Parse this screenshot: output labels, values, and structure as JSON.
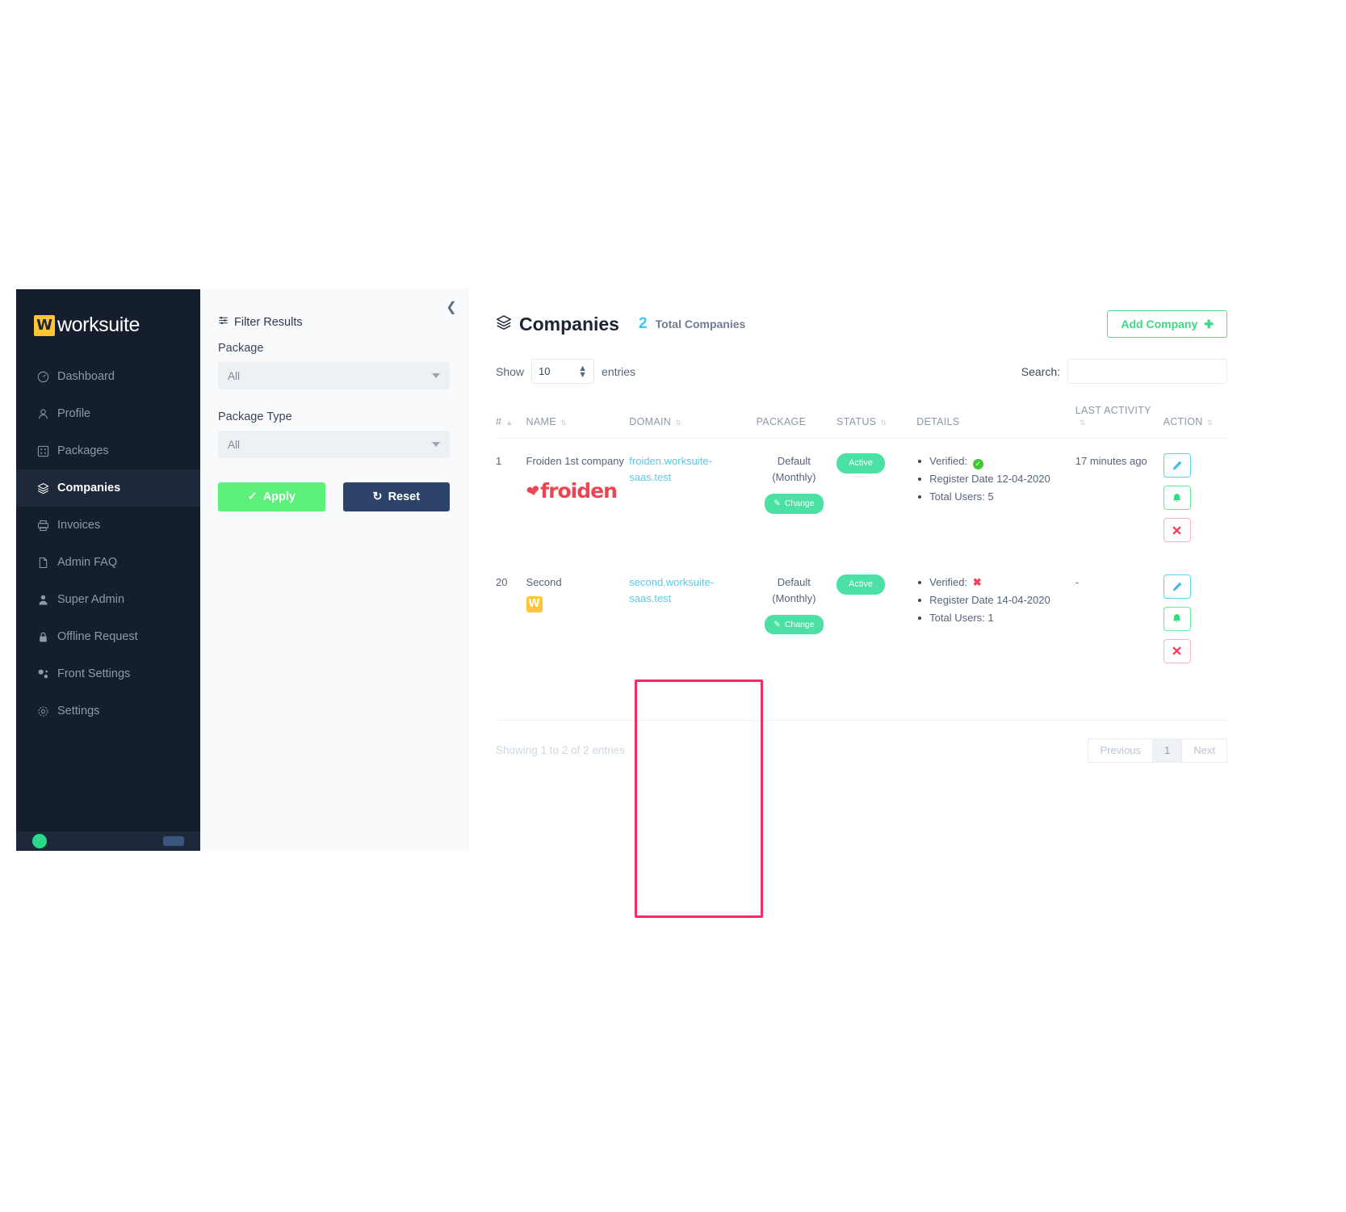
{
  "brand": {
    "mark": "W",
    "name": "worksuite"
  },
  "sidebar": {
    "items": [
      {
        "label": "Dashboard",
        "icon": "speedometer-icon",
        "active": false
      },
      {
        "label": "Profile",
        "icon": "user-icon",
        "active": false
      },
      {
        "label": "Packages",
        "icon": "grid-icon",
        "active": false
      },
      {
        "label": "Companies",
        "icon": "layers-icon",
        "active": true
      },
      {
        "label": "Invoices",
        "icon": "printer-icon",
        "active": false
      },
      {
        "label": "Admin FAQ",
        "icon": "file-icon",
        "active": false
      },
      {
        "label": "Super Admin",
        "icon": "person-filled-icon",
        "active": false
      },
      {
        "label": "Offline Request",
        "icon": "lock-icon",
        "active": false
      },
      {
        "label": "Front Settings",
        "icon": "sliders-icon",
        "active": false
      },
      {
        "label": "Settings",
        "icon": "gear-icon",
        "active": false
      }
    ]
  },
  "filters": {
    "title": "Filter Results",
    "collapse_icon": "chevron-left-icon",
    "package": {
      "label": "Package",
      "value": "All"
    },
    "package_type": {
      "label": "Package Type",
      "value": "All"
    },
    "apply_label": "Apply",
    "reset_label": "Reset"
  },
  "main": {
    "title": "Companies",
    "total_count": "2",
    "total_label": "Total Companies",
    "add_button": "Add Company",
    "show_label": "Show",
    "entries_value": "10",
    "entries_label": "entries",
    "search_label": "Search:",
    "search_value": "",
    "columns": [
      {
        "key": "num",
        "label": "#"
      },
      {
        "key": "name",
        "label": "NAME"
      },
      {
        "key": "domain",
        "label": "DOMAIN"
      },
      {
        "key": "package",
        "label": "PACKAGE"
      },
      {
        "key": "status",
        "label": "STATUS"
      },
      {
        "key": "details",
        "label": "DETAILS"
      },
      {
        "key": "last",
        "label": "LAST ACTIVITY"
      },
      {
        "key": "action",
        "label": "ACTION"
      }
    ],
    "rows": [
      {
        "num": "1",
        "name": "Froiden 1st company",
        "logo": "froiden",
        "domain": "froiden.worksuite-saas.test",
        "package": "Default (Monthly)",
        "change_label": "Change",
        "status": "Active",
        "details": {
          "verified_label": "Verified:",
          "verified": true,
          "register_date": "Register Date 12-04-2020",
          "total_users": "Total Users: 5"
        },
        "last_activity": "17 minutes ago",
        "actions": [
          "edit",
          "notify",
          "delete"
        ]
      },
      {
        "num": "20",
        "name": "Second",
        "logo": "w-badge",
        "domain": "second.worksuite-saas.test",
        "package": "Default (Monthly)",
        "change_label": "Change",
        "status": "Active",
        "details": {
          "verified_label": "Verified:",
          "verified": false,
          "register_date": "Register Date 14-04-2020",
          "total_users": "Total Users: 1"
        },
        "last_activity": "-",
        "actions": [
          "edit",
          "notify",
          "delete"
        ]
      }
    ],
    "footer_info": "Showing 1 to 2 of 2 entries",
    "pagination": {
      "previous": "Previous",
      "current": "1",
      "next": "Next"
    }
  },
  "colors": {
    "sidebar_bg": "#151e2d",
    "accent_green": "#4be0a4",
    "accent_blue": "#5bc8ea",
    "brand_yellow": "#ffc533",
    "danger_red": "#fa3c5a",
    "highlight": "#f52d63"
  }
}
